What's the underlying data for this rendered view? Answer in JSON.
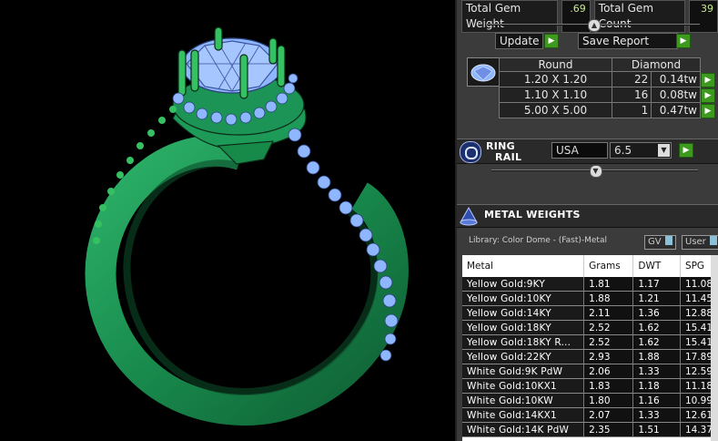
{
  "top_stats": {
    "total_gem_weight_label": "Total Gem Weight",
    "total_gem_weight_value": ".69",
    "total_gem_count_label": "Total Gem Count",
    "total_gem_count_value": "39"
  },
  "actions": {
    "update_label": "Update",
    "save_report_label": "Save Report"
  },
  "gems": {
    "shape_header": "Round",
    "type_header": "Diamond",
    "rows": [
      {
        "size": "1.20 X 1.20",
        "count": "22",
        "weight": "0.14tw"
      },
      {
        "size": "1.10 X 1.10",
        "count": "16",
        "weight": "0.08tw"
      },
      {
        "size": "5.00 X 5.00",
        "count": "1",
        "weight": "0.47tw"
      }
    ]
  },
  "ring_rail": {
    "title_line1": "RING",
    "title_line2": "RAIL",
    "region": "USA",
    "size": "6.5"
  },
  "metal_weights": {
    "title": "METAL WEIGHTS",
    "library": "Library: Color Dome - (Fast)-Metal",
    "toggle_gv": "GV",
    "toggle_user": "User",
    "columns": [
      "Metal",
      "Grams",
      "DWT",
      "SPG"
    ],
    "rows": [
      {
        "metal": "Yellow Gold:9KY",
        "grams": "1.81",
        "dwt": "1.17",
        "spg": "11.08"
      },
      {
        "metal": "Yellow Gold:10KY",
        "grams": "1.88",
        "dwt": "1.21",
        "spg": "11.45"
      },
      {
        "metal": "Yellow Gold:14KY",
        "grams": "2.11",
        "dwt": "1.36",
        "spg": "12.88"
      },
      {
        "metal": "Yellow Gold:18KY",
        "grams": "2.52",
        "dwt": "1.62",
        "spg": "15.41"
      },
      {
        "metal": "Yellow Gold:18KY R...",
        "grams": "2.52",
        "dwt": "1.62",
        "spg": "15.41"
      },
      {
        "metal": "Yellow Gold:22KY",
        "grams": "2.93",
        "dwt": "1.88",
        "spg": "17.89"
      },
      {
        "metal": "White Gold:9K PdW",
        "grams": "2.06",
        "dwt": "1.33",
        "spg": "12.59"
      },
      {
        "metal": "White Gold:10KX1",
        "grams": "1.83",
        "dwt": "1.18",
        "spg": "11.18"
      },
      {
        "metal": "White Gold:10KW",
        "grams": "1.80",
        "dwt": "1.16",
        "spg": "10.99"
      },
      {
        "metal": "White Gold:14KX1",
        "grams": "2.07",
        "dwt": "1.33",
        "spg": "12.61"
      },
      {
        "metal": "White Gold:14K PdW",
        "grams": "2.35",
        "dwt": "1.51",
        "spg": "14.37"
      }
    ]
  },
  "colors": {
    "ring_green": "#1f8a52",
    "prong_green": "#35c062",
    "gem_blue": "#8fb7ff",
    "go_green": "#3e9a1e",
    "value_text": "#c9e98f"
  }
}
